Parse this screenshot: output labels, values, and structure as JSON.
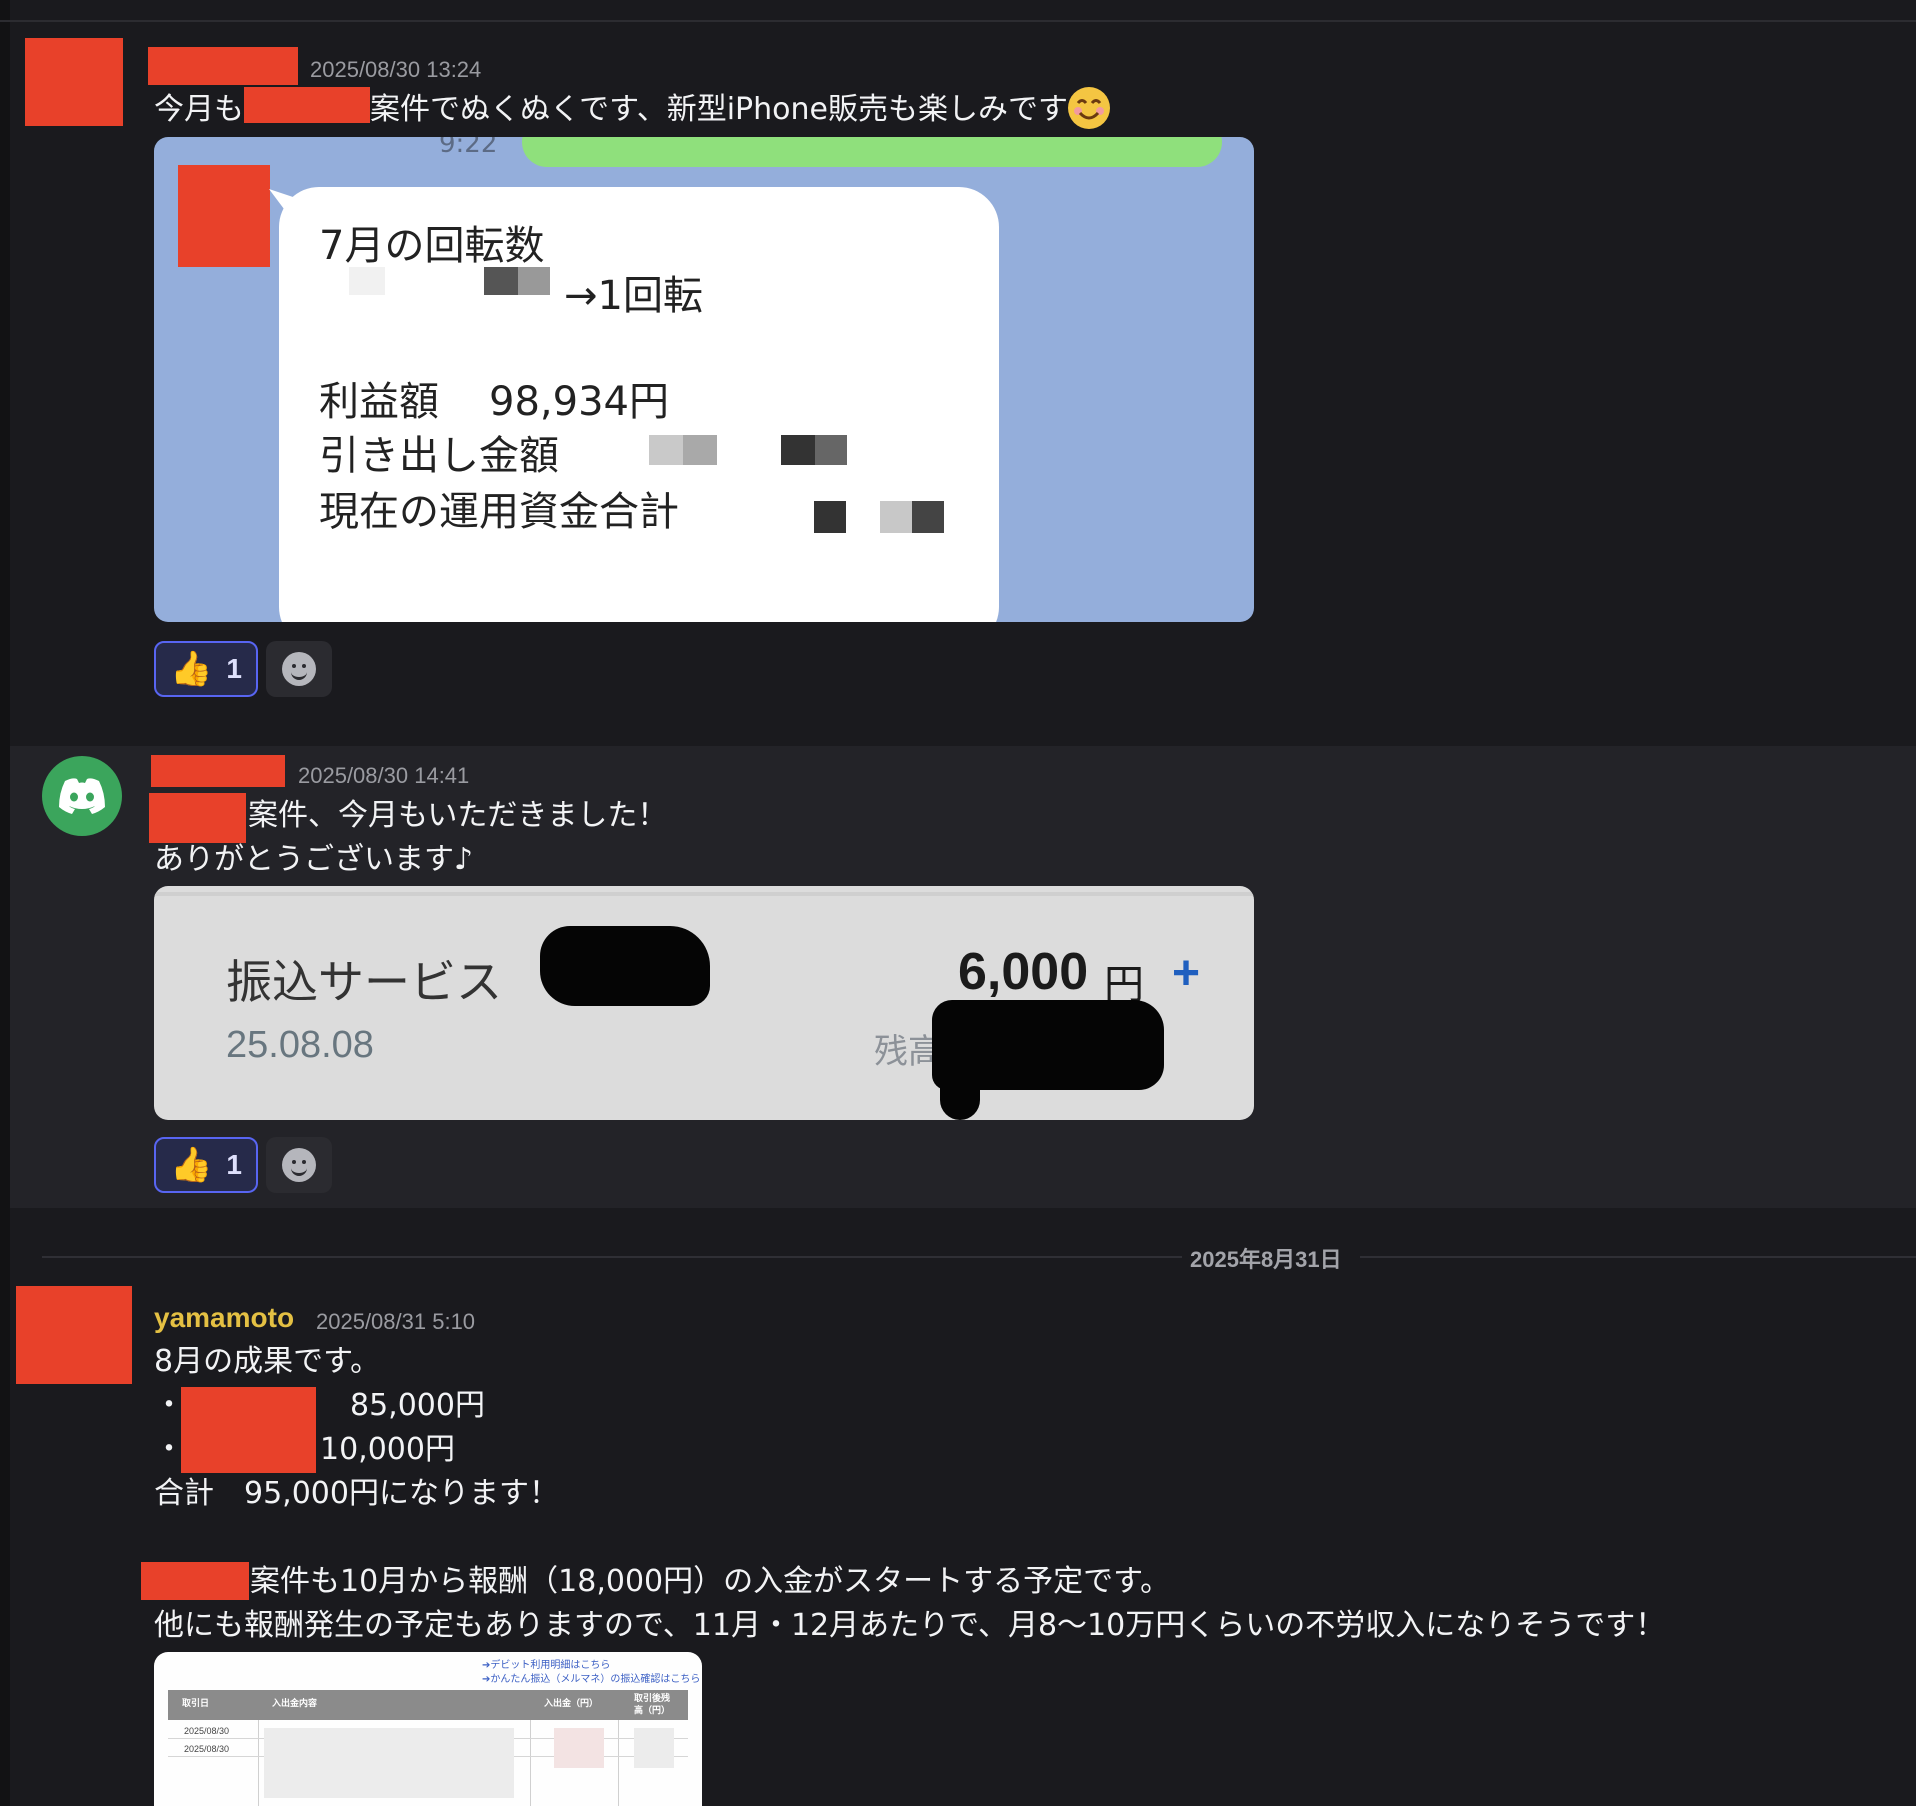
{
  "messages": [
    {
      "timestamp": "2025/08/30 13:24",
      "text_a": "今月も",
      "text_b": "案件でぬくぬくです、新型iPhone販売も楽しみです",
      "emoji": "smiling-face-emoji",
      "image": {
        "time": "9:22",
        "line1": "7月の回転数",
        "line2": "→1回転",
        "line3_label": "利益額",
        "line3_value": "98,934円",
        "line4": "引き出し金額",
        "line5": "現在の運用資金合計"
      },
      "reaction": {
        "emoji": "thumbs-up-icon",
        "count": "1"
      }
    },
    {
      "avatar": "discord-icon",
      "timestamp": "2025/08/30 14:41",
      "line1": "案件、今月もいただきました！",
      "line2": "ありがとうございます♪",
      "image": {
        "service": "振込サービス",
        "date": "25.08.08",
        "amount": "6,000",
        "yen": "円",
        "plus": "+",
        "balance_label": "残高"
      },
      "reaction": {
        "emoji": "thumbs-up-icon",
        "count": "1"
      }
    }
  ],
  "date_divider": "2025年8月31日",
  "message3": {
    "username": "yamamoto",
    "timestamp": "2025/08/31 5:10",
    "line1": "8月の成果です。",
    "bullet1_value": "85,000円",
    "bullet2_value": "10,000円",
    "bullet": "・",
    "total": "合計　95,000円になります！",
    "line_case": "案件も10月から報酬（18,000円）の入金がスタートする予定です。",
    "line_other": "他にも報酬発生の予定もありますので、11月・12月あたりで、月8〜10万円くらいの不労収入になりそうです！",
    "image": {
      "link1": "➔デビット利用明細はこちら",
      "link2": "➔かんたん振込（メルマネ）の振込確認はこちら",
      "col_date": "取引日",
      "col_content": "入出金内容",
      "col_amount": "入出金（円）",
      "col_balance": "取引後残高（円）",
      "row1_date": "2025/08/30",
      "row2_date": "2025/08/30"
    }
  },
  "colors": {
    "background": "#1a1a1e",
    "username": "#e4c043",
    "redaction": "#e8412a",
    "reaction_border": "#5865f2",
    "discord_green": "#3ba55c"
  }
}
